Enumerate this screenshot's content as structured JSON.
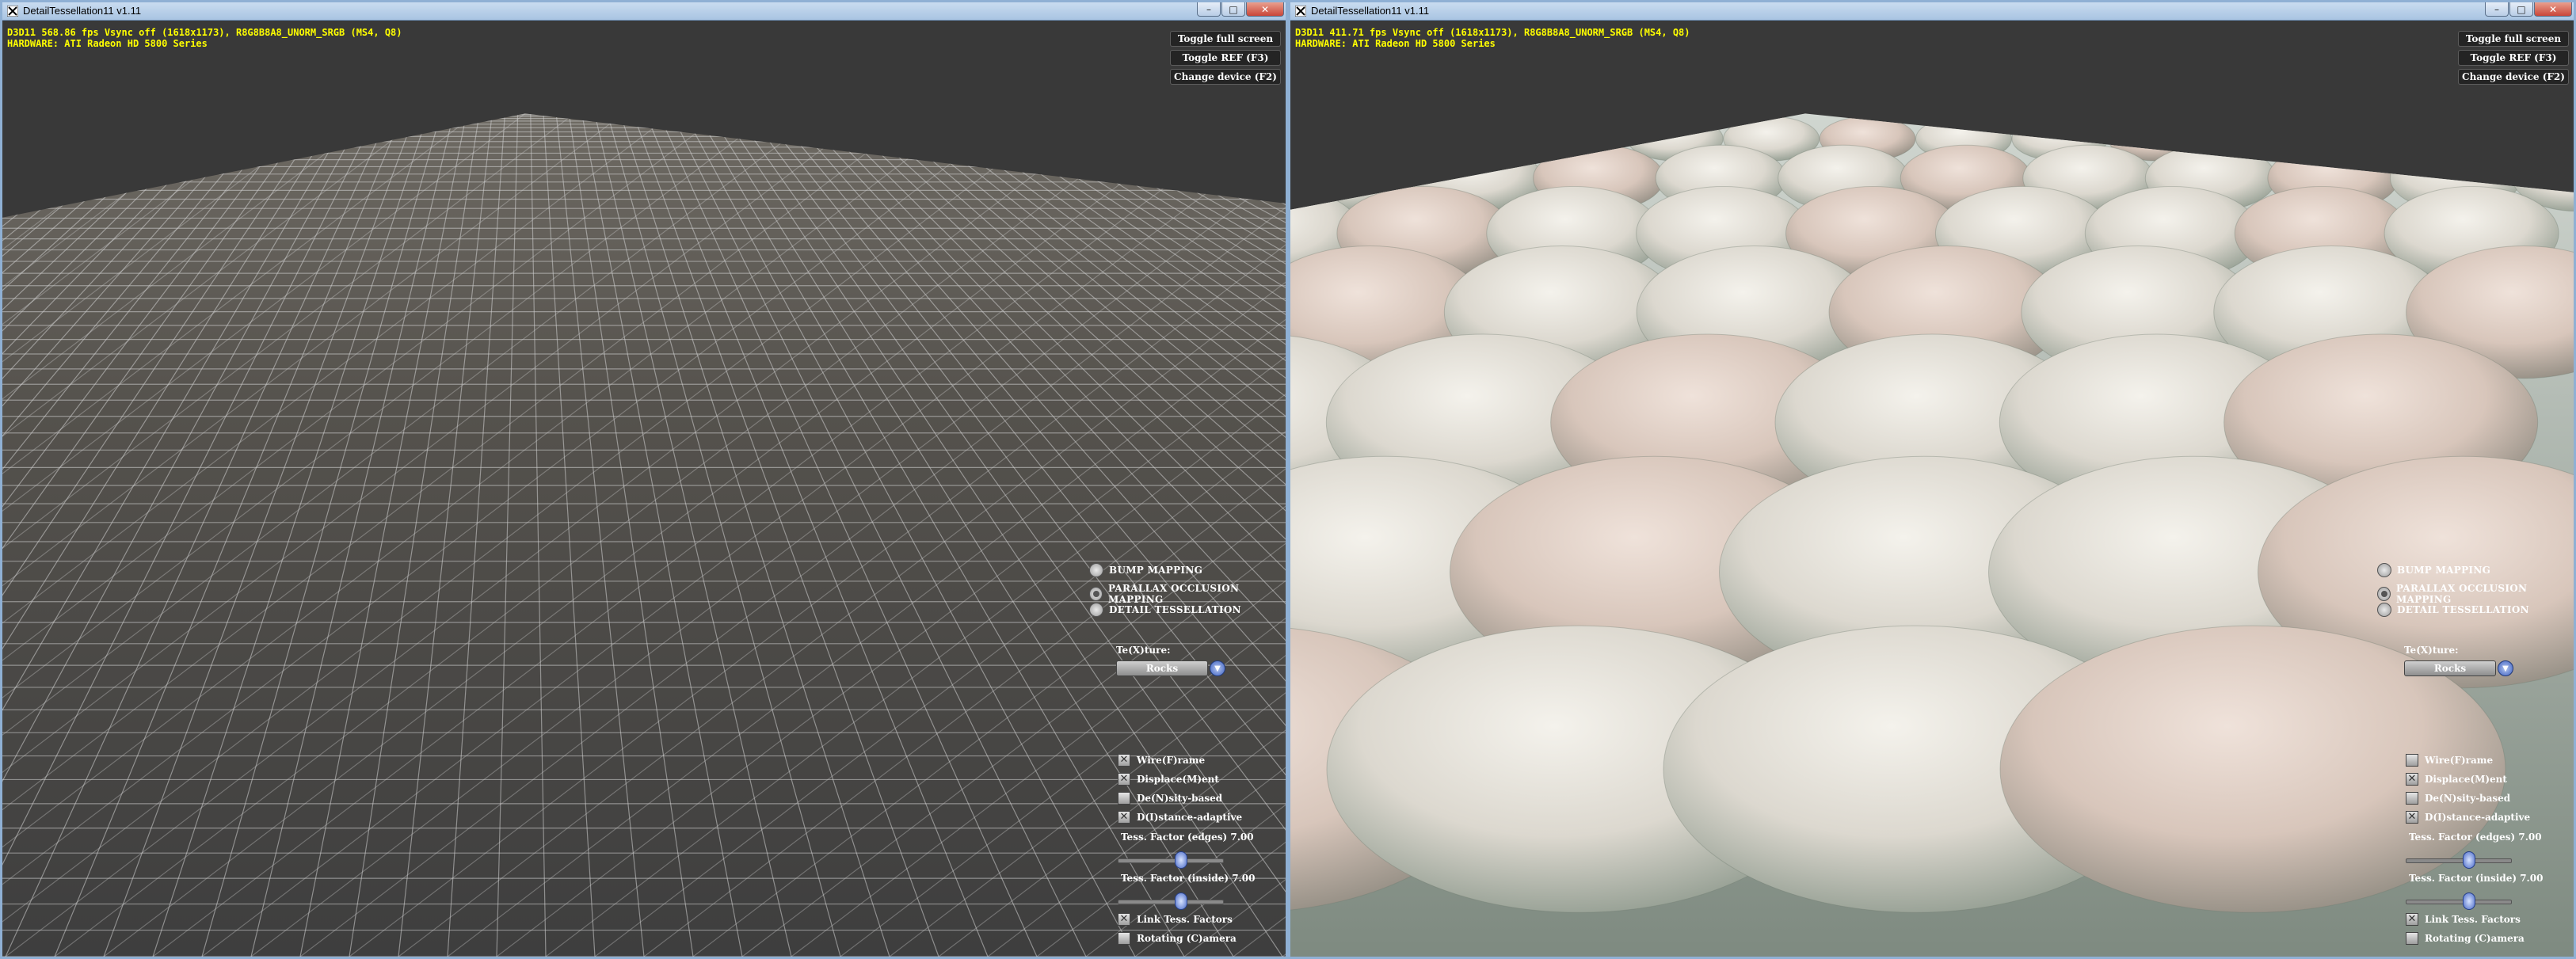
{
  "left_window": {
    "title": "DetailTessellation11 v1.11",
    "stats_line1": "D3D11 568.86 fps Vsync off (1618x1173), R8G8B8A8_UNORM_SRGB (MS4, Q8)",
    "stats_line2": "HARDWARE: ATI Radeon HD 5800 Series",
    "buttons": {
      "toggle_full": "Toggle full screen",
      "toggle_ref": "Toggle REF (F3)",
      "change_device": "Change device (F2)"
    },
    "modes": [
      "BUMP MAPPING",
      "PARALLAX OCCLUSION MAPPING",
      "DETAIL TESSELLATION"
    ],
    "selected_mode": "PARALLAX OCCLUSION MAPPING",
    "texture_label": "Te(X)ture:",
    "texture_value": "Rocks",
    "checks": [
      {
        "label": "Wire(F)rame",
        "checked": true
      },
      {
        "label": "Displace(M)ent",
        "checked": true
      },
      {
        "label": "De(N)sity-based",
        "checked": false
      },
      {
        "label": "D(I)stance-adaptive",
        "checked": true
      }
    ],
    "tess_edges": "Tess. Factor (edges) 7.00",
    "tess_inside": "Tess. Factor (inside) 7.00",
    "link": {
      "label": "Link Tess. Factors",
      "checked": true
    },
    "rotate": {
      "label": "Rotating (C)amera",
      "checked": false
    }
  },
  "right_window": {
    "title": "DetailTessellation11 v1.11",
    "stats_line1": "D3D11 411.71 fps Vsync off (1618x1173), R8G8B8A8_UNORM_SRGB (MS4, Q8)",
    "stats_line2": "HARDWARE: ATI Radeon HD 5800 Series",
    "buttons": {
      "toggle_full": "Toggle full screen",
      "toggle_ref": "Toggle REF (F3)",
      "change_device": "Change device (F2)"
    },
    "modes": [
      "BUMP MAPPING",
      "PARALLAX OCCLUSION MAPPING",
      "DETAIL TESSELLATION"
    ],
    "selected_mode": "PARALLAX OCCLUSION MAPPING",
    "texture_label": "Te(X)ture:",
    "texture_value": "Rocks",
    "checks": [
      {
        "label": "Wire(F)rame",
        "checked": false
      },
      {
        "label": "Displace(M)ent",
        "checked": true
      },
      {
        "label": "De(N)sity-based",
        "checked": false
      },
      {
        "label": "D(I)stance-adaptive",
        "checked": true
      }
    ],
    "tess_edges": "Tess. Factor (edges) 7.00",
    "tess_inside": "Tess. Factor (inside) 7.00",
    "link": {
      "label": "Link Tess. Factors",
      "checked": true
    },
    "rotate": {
      "label": "Rotating (C)amera",
      "checked": false
    }
  },
  "caption": {
    "minimize": "–",
    "maximize": "□",
    "close": "✕"
  },
  "colors": {
    "stats_text": "#ffff00",
    "ui_text": "#ffffff",
    "slider_accent": "#4a6ac8"
  },
  "icons": {
    "app": "directx-app-icon",
    "dropdown": "chevron-down-icon"
  }
}
